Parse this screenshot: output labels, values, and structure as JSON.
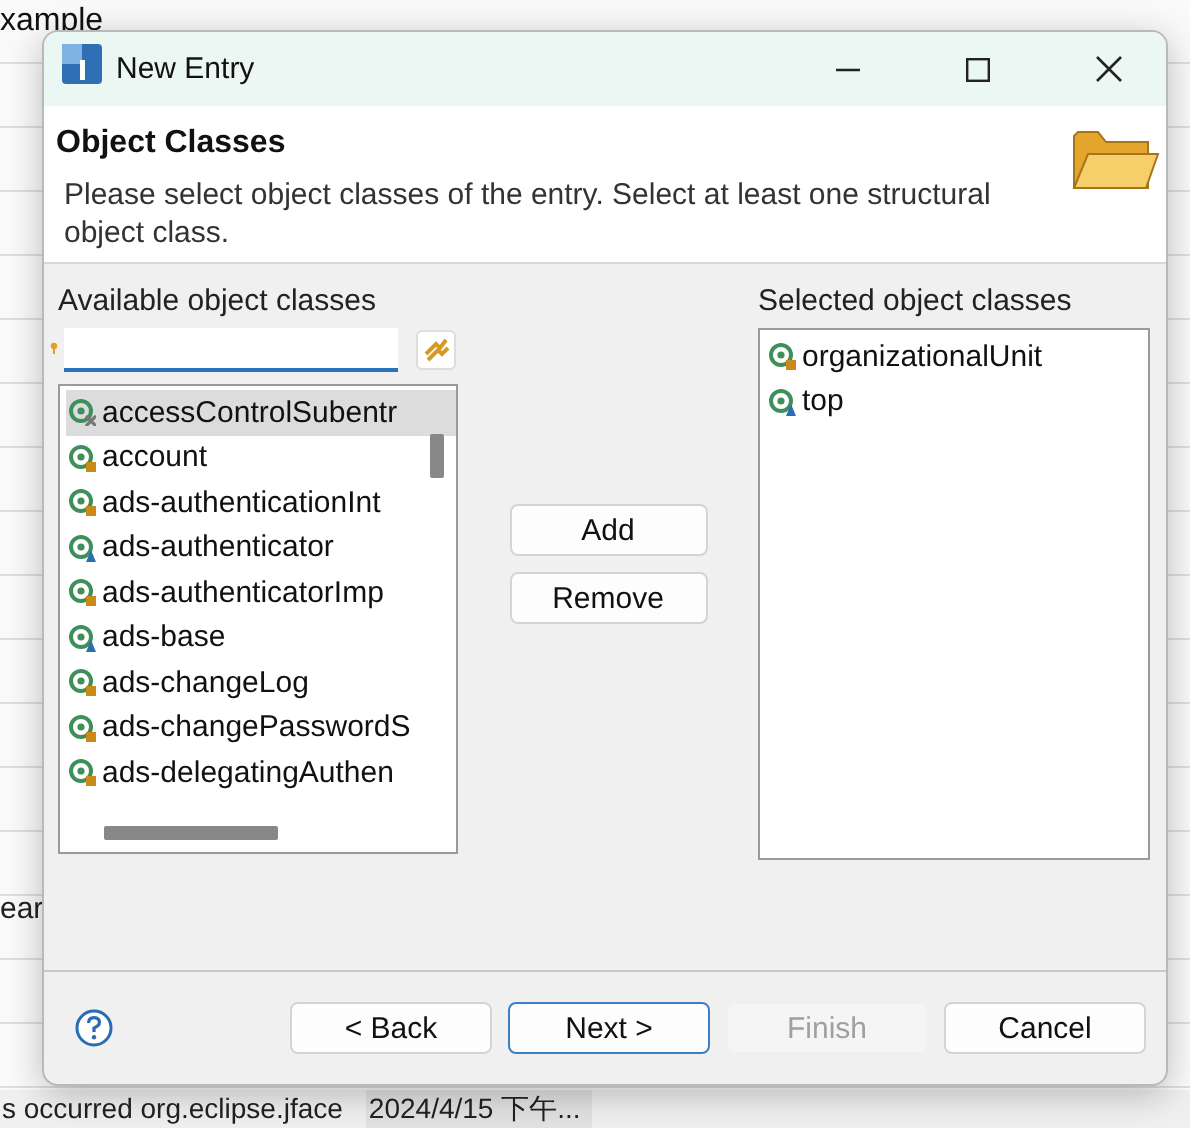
{
  "background": {
    "heading": "xample",
    "side_text": "ear",
    "status_message": "s occurred org.eclipse.jface",
    "status_time": "2024/4/15 下午..."
  },
  "window": {
    "title": "New Entry"
  },
  "header": {
    "title": "Object Classes",
    "description": "Please select object classes of the entry. Select at least one structural object class."
  },
  "available": {
    "label": "Available object classes",
    "items": [
      {
        "name": "accessControlSubentr",
        "kind": "auxiliary",
        "selected": true
      },
      {
        "name": "account",
        "kind": "structural",
        "selected": false
      },
      {
        "name": "ads-authenticationInt",
        "kind": "structural",
        "selected": false
      },
      {
        "name": "ads-authenticator",
        "kind": "abstract",
        "selected": false
      },
      {
        "name": "ads-authenticatorImp",
        "kind": "structural",
        "selected": false
      },
      {
        "name": "ads-base",
        "kind": "abstract",
        "selected": false
      },
      {
        "name": "ads-changeLog",
        "kind": "structural",
        "selected": false
      },
      {
        "name": "ads-changePasswordS",
        "kind": "structural",
        "selected": false
      },
      {
        "name": "ads-delegatingAuthen",
        "kind": "structural",
        "selected": false
      }
    ]
  },
  "move_buttons": [
    {
      "label": "Add"
    },
    {
      "label": "Remove"
    }
  ],
  "selected_classes": {
    "label": "Selected object classes",
    "items": [
      {
        "name": "organizationalUnit",
        "kind": "structural",
        "selected": false
      },
      {
        "name": "top",
        "kind": "abstract",
        "selected": false
      }
    ]
  },
  "nav_buttons": [
    {
      "label": "< Back",
      "disabled": false,
      "default": false
    },
    {
      "label": "Next >",
      "disabled": false,
      "default": true
    },
    {
      "label": "Finish",
      "disabled": true,
      "default": false
    },
    {
      "label": "Cancel",
      "disabled": false,
      "default": false
    }
  ]
}
